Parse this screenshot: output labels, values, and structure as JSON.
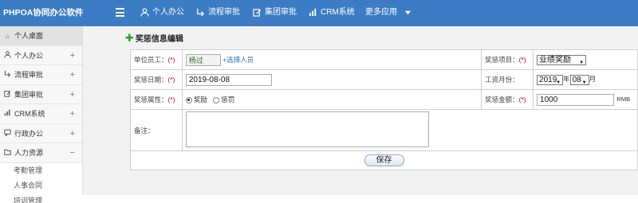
{
  "app": {
    "title": "PHPOA协同办公软件"
  },
  "topnav": [
    {
      "label": "个人办公",
      "icon": "user-icon"
    },
    {
      "label": "流程审批",
      "icon": "flow-icon"
    },
    {
      "label": "集团审批",
      "icon": "edit-icon"
    },
    {
      "label": "CRM系统",
      "icon": "bar-chart-icon"
    },
    {
      "label": "更多应用",
      "icon": "caret-down-icon"
    }
  ],
  "sidebar": {
    "items": [
      {
        "label": "个人桌面",
        "icon": "home-icon",
        "toggle": ""
      },
      {
        "label": "个人办公",
        "icon": "user-icon",
        "toggle": "+"
      },
      {
        "label": "流程审批",
        "icon": "flow-icon",
        "toggle": "+"
      },
      {
        "label": "集团审批",
        "icon": "edit-icon",
        "toggle": "+"
      },
      {
        "label": "CRM系统",
        "icon": "bar-chart-icon",
        "toggle": "+"
      },
      {
        "label": "行政办公",
        "icon": "chat-icon",
        "toggle": "+"
      },
      {
        "label": "人力资源",
        "icon": "folder-icon",
        "toggle": "−"
      }
    ],
    "subitems": [
      "考勤管理",
      "人事合同",
      "培训管理"
    ]
  },
  "page": {
    "title": "奖惩信息编辑"
  },
  "form": {
    "employee": {
      "label": "单位员工：",
      "req": "(*)",
      "value": "杨过",
      "link": "+选择人员"
    },
    "item": {
      "label": "奖惩项目：",
      "req": "(*)",
      "value": "业绩奖励"
    },
    "date": {
      "label": "奖惩日期：",
      "req": "(*)",
      "value": "2019-08-08"
    },
    "salary_month": {
      "label": "工资月份：",
      "year": "2019",
      "year_unit": "年",
      "month": "08",
      "month_unit": "月"
    },
    "property": {
      "label": "奖惩属性：",
      "req": "(*)",
      "options": [
        "奖励",
        "惩罚"
      ],
      "selected": "奖励"
    },
    "amount": {
      "label": "奖惩金额：",
      "req": "(*)",
      "value": "1000",
      "unit": "RMB"
    },
    "remark": {
      "label": "备注：",
      "value": ""
    },
    "save_label": "保存"
  },
  "colors": {
    "topbar": "#3b7cc4",
    "link": "#2a6ec6",
    "required": "#e0000a"
  }
}
